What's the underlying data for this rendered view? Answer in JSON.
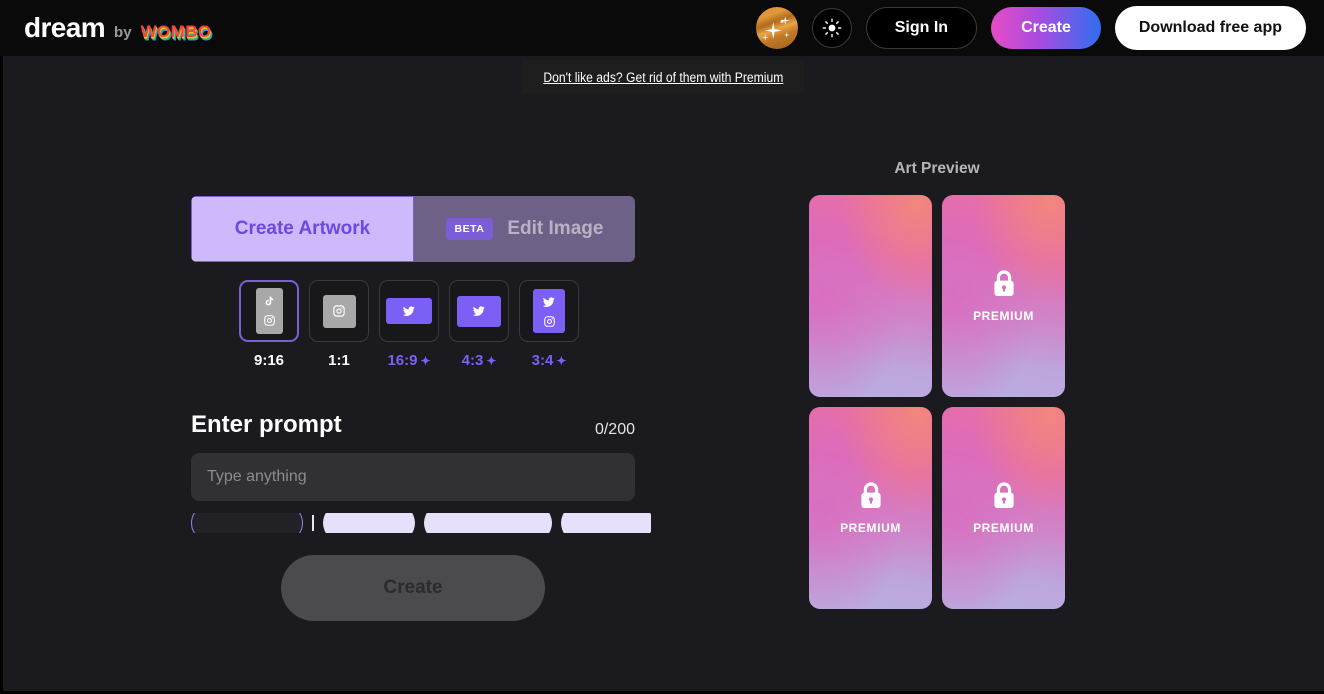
{
  "header": {
    "logo_main": "dream",
    "logo_by": "by",
    "logo_brand": "WOMBO",
    "avatar_icon": "planet-sparkle-avatar",
    "theme_toggle_icon": "sun-brightness-icon",
    "sign_in_label": "Sign In",
    "create_label": "Create",
    "download_label": "Download free app",
    "create_gradient_from": "#e74bc7",
    "create_gradient_to": "#2f6ef0"
  },
  "ad_banner": {
    "text": "Don't like ads? Get rid of them with Premium"
  },
  "tabs": [
    {
      "label": "Create Artwork",
      "active": true,
      "badge": ""
    },
    {
      "label": "Edit Image",
      "active": false,
      "badge": "BETA"
    }
  ],
  "aspect_ratios": [
    {
      "label": "9:16",
      "selected": true,
      "premium": false,
      "thumb_color": "gray",
      "thumb_class": "t-9-16",
      "icons": [
        "tiktok-icon",
        "instagram-icon"
      ]
    },
    {
      "label": "1:1",
      "selected": false,
      "premium": false,
      "thumb_color": "gray",
      "thumb_class": "t-1-1",
      "icons": [
        "instagram-icon"
      ]
    },
    {
      "label": "16:9",
      "selected": false,
      "premium": true,
      "thumb_color": "purple",
      "thumb_class": "t-16-9",
      "icons": [
        "twitter-icon"
      ]
    },
    {
      "label": "4:3",
      "selected": false,
      "premium": true,
      "thumb_color": "purple",
      "thumb_class": "t-4-3",
      "icons": [
        "twitter-icon"
      ]
    },
    {
      "label": "3:4",
      "selected": false,
      "premium": true,
      "thumb_color": "purple",
      "thumb_class": "t-3-4",
      "icons": [
        "twitter-icon",
        "instagram-icon"
      ]
    }
  ],
  "premium_sparkle_glyph": "✦",
  "prompt": {
    "title": "Enter prompt",
    "counter": "0/200",
    "placeholder": "Type anything",
    "value": ""
  },
  "style_chips": [
    {
      "label": "",
      "selected": true
    },
    {
      "label": "",
      "selected": false
    },
    {
      "label": "",
      "selected": false
    },
    {
      "label": "",
      "selected": false
    }
  ],
  "create_button": {
    "label": "Create",
    "disabled": true
  },
  "art_preview": {
    "title": "Art Preview",
    "premium_label": "PREMIUM",
    "lock_icon": "lock-icon",
    "cards": [
      {
        "premium": false
      },
      {
        "premium": true
      },
      {
        "premium": true
      },
      {
        "premium": true
      }
    ]
  },
  "colors": {
    "accent_purple": "#7c5ff5",
    "tab_active_bg": "#cdb9fb",
    "page_bg": "#1b1b1f",
    "header_bg": "#0a0a0a"
  }
}
